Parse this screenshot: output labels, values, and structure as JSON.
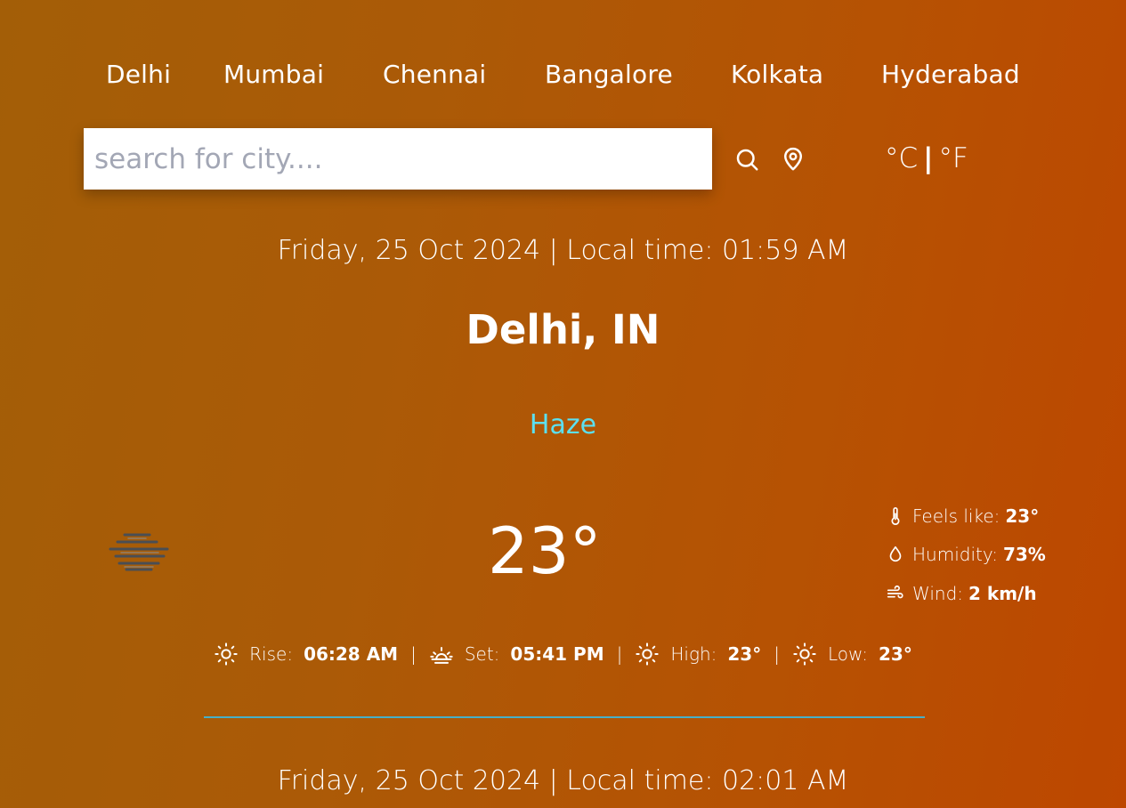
{
  "nav": {
    "cities": [
      "Delhi",
      "Mumbai",
      "Chennai",
      "Bangalore",
      "Kolkata",
      "Hyderabad"
    ]
  },
  "search": {
    "placeholder": "search for city....",
    "value": "",
    "search_icon": "search-icon",
    "location_icon": "map-pin-icon"
  },
  "units": {
    "celsius": "°C",
    "separator": "|",
    "fahrenheit": "°F"
  },
  "current": {
    "datetime": "Friday, 25 Oct 2024 | Local time: 01:59 AM",
    "location": "Delhi, IN",
    "condition": "Haze",
    "condition_icon": "haze-icon",
    "temperature": "23°",
    "details": {
      "feels_like_label": "Feels like:",
      "feels_like": "23°",
      "humidity_label": "Humidity:",
      "humidity": "73%",
      "wind_label": "Wind:",
      "wind": "2 km/h"
    },
    "sun": {
      "rise_label": "Rise:",
      "rise": "06:28 AM",
      "set_label": "Set:",
      "set": "05:41 PM",
      "high_label": "High:",
      "high": "23°",
      "low_label": "Low:",
      "low": "23°",
      "separator": "|"
    }
  },
  "next": {
    "datetime": "Friday, 25 Oct 2024 | Local time: 02:01 AM"
  },
  "colors": {
    "background_start": "#a35e07",
    "background_end": "#bd4700",
    "condition_text": "#5ce0f0",
    "divider": "#47b0c7"
  }
}
